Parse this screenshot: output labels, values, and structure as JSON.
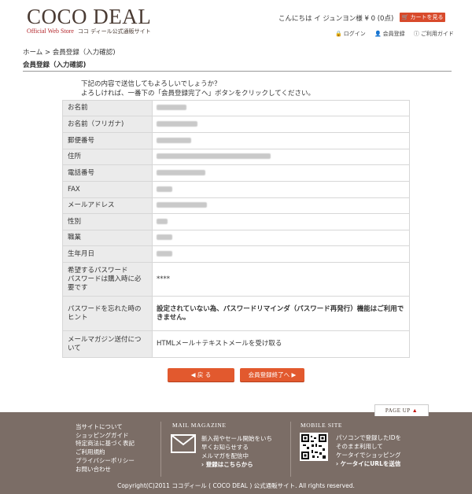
{
  "header": {
    "logo": "COCO DEAL",
    "logo_sub_en": "Official Web Store",
    "logo_sub_jp": "ココ ディール公式通販サイト",
    "greeting": "こんにちは イ ジュンヨン様 ¥ 0 (0点)",
    "cart_button": "カートを見る",
    "links": [
      "ログイン",
      "会員登録",
      "ご利用ガイド"
    ]
  },
  "breadcrumb": {
    "home": "ホーム",
    "sep": ">",
    "current": "会員登録（入力確認)"
  },
  "section_title": "会員登録（入力確認)",
  "intro": {
    "line1": "下記の内容で送信してもよろしいでしょうか？",
    "line2": "よろしければ、一番下の「会員登録完了へ」ボタンをクリックしてください。"
  },
  "form": {
    "name": "お名前",
    "kana": "お名前（フリガナ)",
    "zip": "郵便番号",
    "address": "住所",
    "phone": "電話番号",
    "fax": "FAX",
    "email": "メールアドレス",
    "gender": "性別",
    "job": "職業",
    "birthday": "生年月日",
    "password_l1": "希望するパスワード",
    "password_l2": "パスワードは購入時に必要です",
    "password_value": "****",
    "reminder_label": "パスワードを忘れた時のヒント",
    "reminder_value": "設定されていない為、パスワードリマインダ（パスワード再発行）機能はご利用できません。",
    "magazine_label": "メールマガジン送付について",
    "magazine_value": "HTMLメール＋テキストメールを受け取る"
  },
  "buttons": {
    "back": "◀  戻 る",
    "next": "会員登録終了へ ▶"
  },
  "footer": {
    "pageup": "PAGE UP",
    "pageup_tri": "▲",
    "links": [
      "当サイトについて",
      "ショッピングガイド",
      "特定商法に基づく表記",
      "ご利用規約",
      "プライバシーポリシー",
      "お問い合わせ"
    ],
    "magazine_title": "MAIL MAGAZINE",
    "magazine_lines": [
      "新入荷やセール開始をいち",
      "早くお知らせする",
      "メルマガを配信中"
    ],
    "magazine_link": "› 登録はこちらから",
    "mobile_title": "MOBILE SITE",
    "mobile_lines": [
      "パソコンで登録したIDを",
      "そのまま利用して",
      "ケータイでショッピング"
    ],
    "mobile_link": "› ケータイにURLを送信",
    "copyright": "Copyright(C)2011 ココディール ( COCO DEAL ) 公式通販サイト. All rights reserved."
  },
  "colors": {
    "accent": "#e2592e",
    "warning": "#c4140f",
    "footer_bg": "#7b6d66"
  }
}
